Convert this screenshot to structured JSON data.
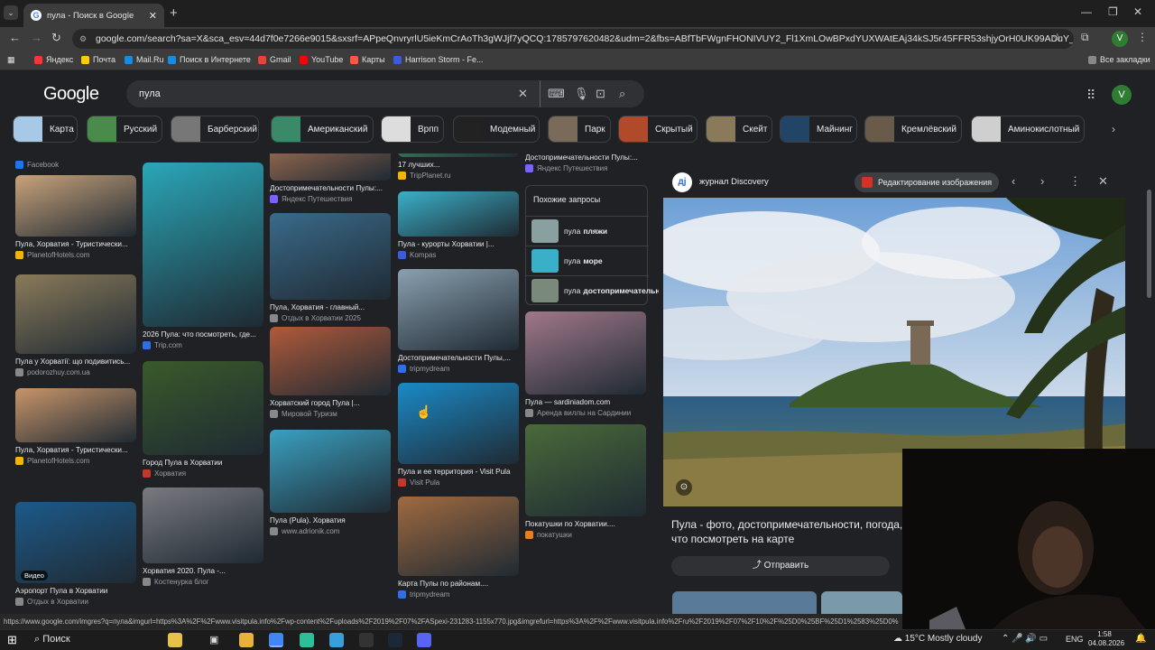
{
  "browser": {
    "tab_title": "пула - Поиск в Google",
    "url": "google.com/search?sa=X&sca_esv=44d7f0e7266e9015&sxsrf=APpeQnvryrlU5ieKmCrAoTh3gWJjf7yQCQ:1785797620482&udm=2&fbs=ABfTbFWgnFHONIVUY2_Fl1XmLOwBPxdYUXWAtEAj34kSJ5r45FFR53shjyOrH0UK99ADuY_I944N49_ToyGoqukIx6RmNs...",
    "bookmarks": [
      {
        "label": "Яндекс",
        "color": "#ff3333"
      },
      {
        "label": "Почта",
        "color": "#ffcc00"
      },
      {
        "label": "Mail.Ru",
        "color": "#168de2"
      },
      {
        "label": "Поиск в Интернете",
        "color": "#168de2"
      },
      {
        "label": "Gmail",
        "color": "#ea4335"
      },
      {
        "label": "YouTube",
        "color": "#ff0000"
      },
      {
        "label": "Карты",
        "color": "#ff5544"
      },
      {
        "label": "Harrison Storm - Fe...",
        "color": "#3b5bdb"
      }
    ],
    "all_bookmarks": "Все закладки",
    "profile_initial": "V"
  },
  "google": {
    "logo": "Google",
    "query": "пула",
    "avatar": "V",
    "chips": [
      "Карта",
      "Русский",
      "Барберский",
      "Американский",
      "Врпп",
      "Модемный",
      "Парк",
      "Скрытый",
      "Скейт",
      "Майнинг",
      "Кремлёвский",
      "Аминокислотный"
    ]
  },
  "results": {
    "col1": [
      {
        "title": "",
        "source": "Facebook",
        "src_color": "#1877f2"
      },
      {
        "title": "Пула, Хорватия - Туристически...",
        "source": "PlanetofHotels.com",
        "src_color": "#f4b400"
      },
      {
        "title": "Пула у Хорватії: що подивитись...",
        "source": "podorozhuy.com.ua",
        "src_color": "#888888"
      },
      {
        "title": "Пула, Хорватия - Туристически...",
        "source": "PlanetofHotels.com",
        "src_color": "#f4b400"
      },
      {
        "title": "Аэропорт Пула в Хорватии",
        "source": "Отдых в Хорватии",
        "src_color": "#888888",
        "badge": "Видео"
      }
    ],
    "col2": [
      {
        "title": "2026 Пула: что посмотреть, где...",
        "source": "Trip.com",
        "src_color": "#2f6fe4"
      },
      {
        "title": "Город Пула в Хорватии",
        "source": "Хорватия",
        "src_color": "#c0392b"
      },
      {
        "title": "Хорватия 2020. Пула -...",
        "source": "Костенурка блог",
        "src_color": "#888888"
      }
    ],
    "col3": [
      {
        "title": "Достопримечательности Пулы:...",
        "source": "Яндекс Путешествия",
        "src_color": "#7b61ff"
      },
      {
        "title": "Пула, Хорватия - главный...",
        "source": "Отдых в Хорватии 2025",
        "src_color": "#888888"
      },
      {
        "title": "Хорватский город Пула |...",
        "source": "Мировой Туризм",
        "src_color": "#888888"
      },
      {
        "title": "Пула (Pula). Хорватия",
        "source": "www.adrionik.com",
        "src_color": "#888888"
      }
    ],
    "col4": [
      {
        "title": "17 лучших...",
        "source": "TripPlanet.ru",
        "src_color": "#f4b400"
      },
      {
        "title": "Пула - курорты Хорватии |...",
        "source": "Kompas",
        "src_color": "#3b5bdb"
      },
      {
        "title": "Достопримечательности Пулы,...",
        "source": "tripmydream",
        "src_color": "#2f6fe4"
      },
      {
        "title": "Пула и ее территория - Visit Pula",
        "source": "Visit Pula",
        "src_color": "#c0392b"
      },
      {
        "title": "Карта Пулы по районам....",
        "source": "tripmydream",
        "src_color": "#2f6fe4"
      }
    ],
    "col5": [
      {
        "title": "Достопримечательности Пулы:...",
        "source": "Яндекс Путешествия",
        "src_color": "#7b61ff"
      },
      {
        "title": "Пула — sardiniadom.com",
        "source": "Аренда виллы на Сардинии",
        "src_color": "#888888"
      },
      {
        "title": "Покатушки по Хорватии....",
        "source": "покатушки",
        "src_color": "#e67e22"
      }
    ],
    "related": {
      "header": "Похожие запросы",
      "items": [
        {
          "prefix": "пула",
          "bold": "пляжи"
        },
        {
          "prefix": "пула",
          "bold": "море"
        },
        {
          "prefix": "пула",
          "bold": "достопримечательн"
        }
      ]
    }
  },
  "panel": {
    "source_name": "журнал Discovery",
    "source_initial": "дj",
    "edit_label": "Редактирование изображения",
    "title": "Пула - фото, достопримечательности, погода, что посмотреть на карте",
    "share_label": "Отправить"
  },
  "status_url": "https://www.google.com/imgres?q=пула&imgurl=https%3A%2F%2Fwww.visitpula.info%2Fwp-content%2Fuploads%2F2019%2F07%2FASpexi-231283-1155x770.jpg&imgrefurl=https%3A%2F%2Fwww.visitpula.info%2Fru%2F2019%2F07%2F10%2F%25D0%25BF%25D1%2583%25D0%",
  "taskbar": {
    "search_label": "Поиск",
    "weather": "15°C  Mostly cloudy",
    "lang": "ENG",
    "time": "1:58",
    "date": "04.08.2026"
  }
}
